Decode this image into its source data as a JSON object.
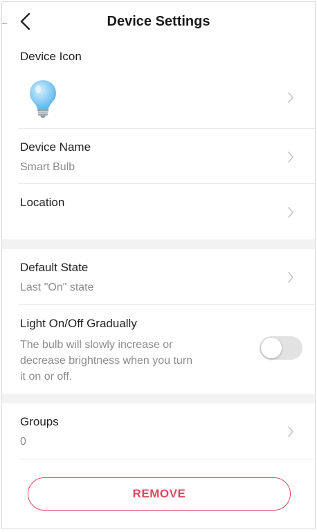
{
  "header": {
    "title": "Device Settings",
    "back_icon": "chevron-left-icon"
  },
  "device_icon": {
    "label": "Device Icon",
    "icon": "lightbulb-icon",
    "icon_color": "#8ccdf5"
  },
  "device_name": {
    "label": "Device Name",
    "value": "Smart Bulb"
  },
  "location": {
    "label": "Location",
    "value": ""
  },
  "default_state": {
    "label": "Default State",
    "value": "Last \"On\" state"
  },
  "gradual": {
    "label": "Light On/Off Gradually",
    "description_lines": [
      "The bulb will slowly increase or",
      "decrease brightness when you turn",
      "it on or off."
    ],
    "toggle_on": false
  },
  "groups": {
    "label": "Groups",
    "value": "0"
  },
  "remove": {
    "label": "REMOVE",
    "color": "#e0485e"
  }
}
